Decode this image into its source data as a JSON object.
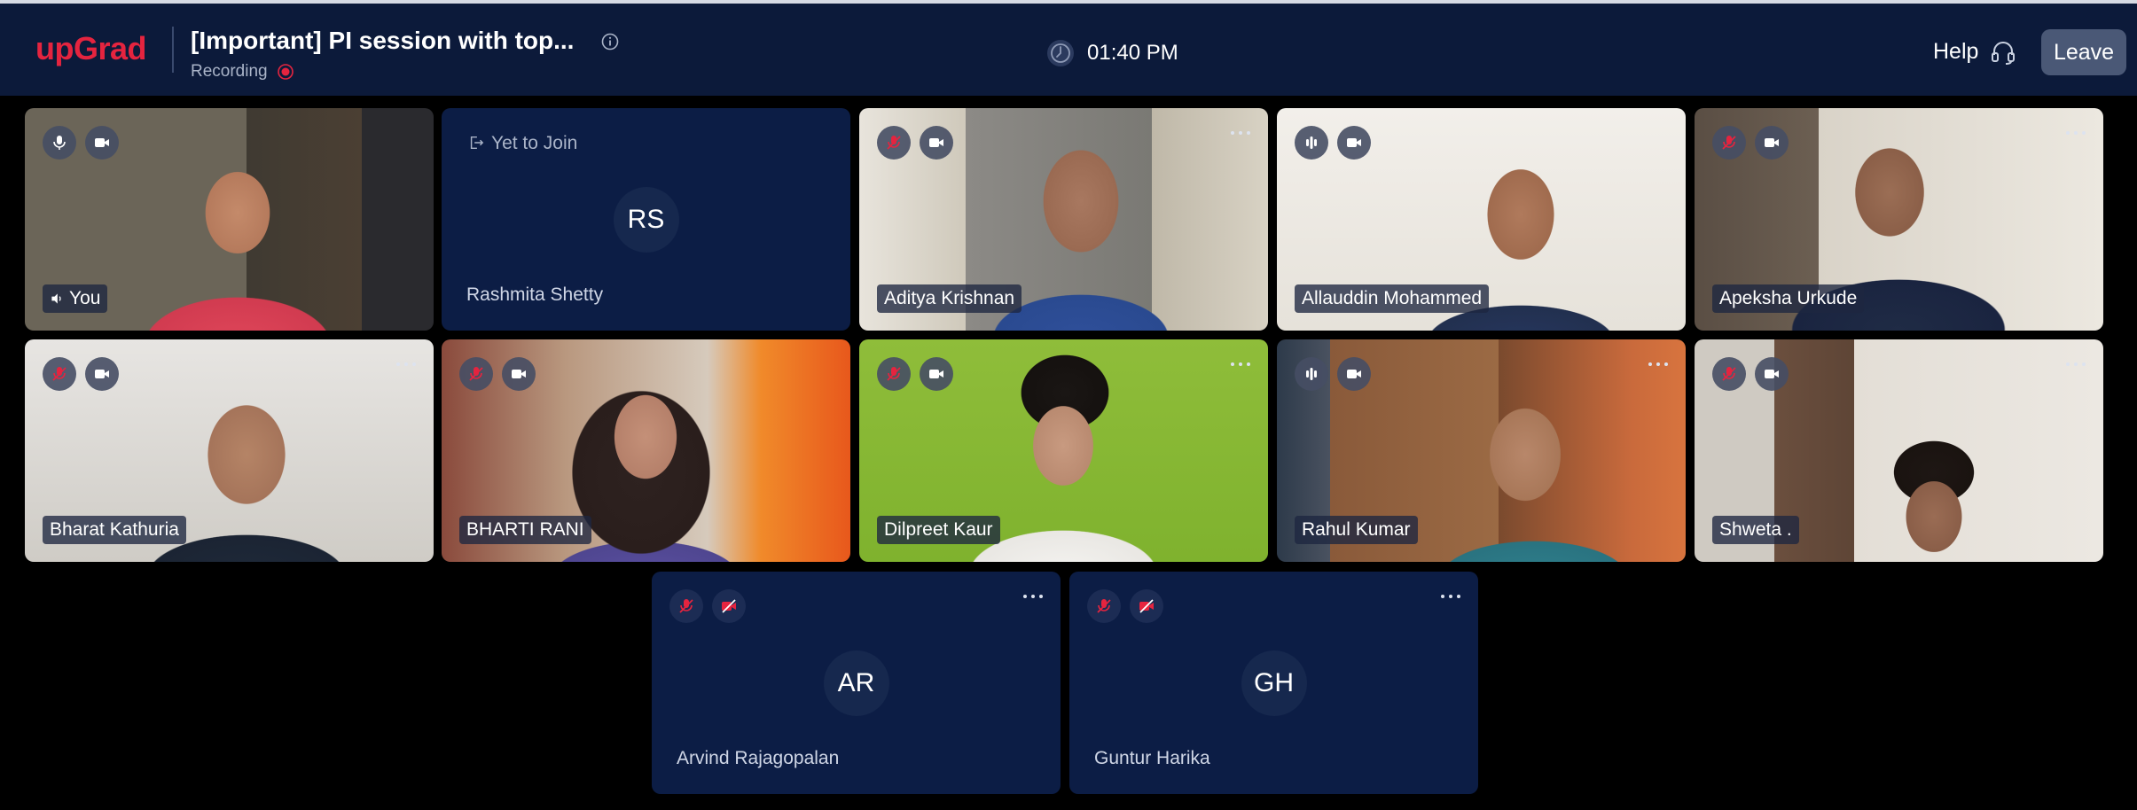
{
  "header": {
    "logo": "upGrad",
    "title": "[Important] PI session with top...",
    "recording_label": "Recording",
    "time": "01:40 PM",
    "help_label": "Help",
    "leave_label": "Leave"
  },
  "colors": {
    "brand": "#e5243f",
    "background": "#0c1a3a",
    "tile_blank": "#0c1d45"
  },
  "participants": [
    {
      "name": "You",
      "video": "on",
      "mic": "on"
    },
    {
      "name": "Rashmita Shetty",
      "status": "Yet to Join",
      "initials": "RS"
    },
    {
      "name": "Aditya Krishnan",
      "video": "on",
      "mic": "muted"
    },
    {
      "name": "Allauddin Mohammed",
      "video": "on",
      "mic": "speaking"
    },
    {
      "name": "Apeksha Urkude",
      "video": "on",
      "mic": "muted"
    },
    {
      "name": "Bharat Kathuria",
      "video": "on",
      "mic": "muted"
    },
    {
      "name": "BHARTI RANI",
      "video": "on",
      "mic": "muted"
    },
    {
      "name": "Dilpreet Kaur",
      "video": "on",
      "mic": "muted"
    },
    {
      "name": "Rahul Kumar",
      "video": "on",
      "mic": "speaking"
    },
    {
      "name": "Shweta .",
      "video": "on",
      "mic": "muted"
    },
    {
      "name": "Arvind Rajagopalan",
      "video": "off",
      "mic": "muted",
      "initials": "AR"
    },
    {
      "name": "Guntur Harika",
      "video": "off",
      "mic": "muted",
      "initials": "GH"
    }
  ],
  "icons": [
    "info-icon",
    "recording-dot-icon",
    "clock-icon",
    "headset-icon",
    "mic-icon",
    "mic-off-icon",
    "camera-icon",
    "camera-off-icon",
    "speaking-icon",
    "more-icon",
    "speaker-icon",
    "exit-icon"
  ]
}
